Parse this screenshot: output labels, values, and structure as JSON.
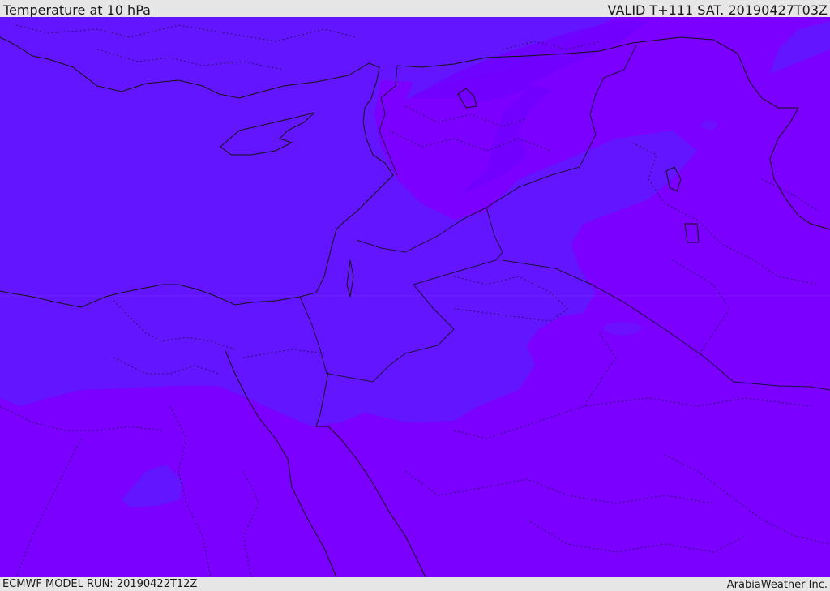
{
  "header": {
    "title": "Temperature at 10 hPa",
    "valid_time": "VALID T+111 SAT. 20190427T03Z"
  },
  "footer": {
    "model_run": "ECMWF MODEL RUN: 20190422T12Z",
    "credit": "ArabiaWeather Inc."
  },
  "map": {
    "field_colors": {
      "colder_band": "#6415ff",
      "warmer_band": "#7b00ff",
      "coastline": "#141414",
      "border": "#2a1a55"
    }
  }
}
